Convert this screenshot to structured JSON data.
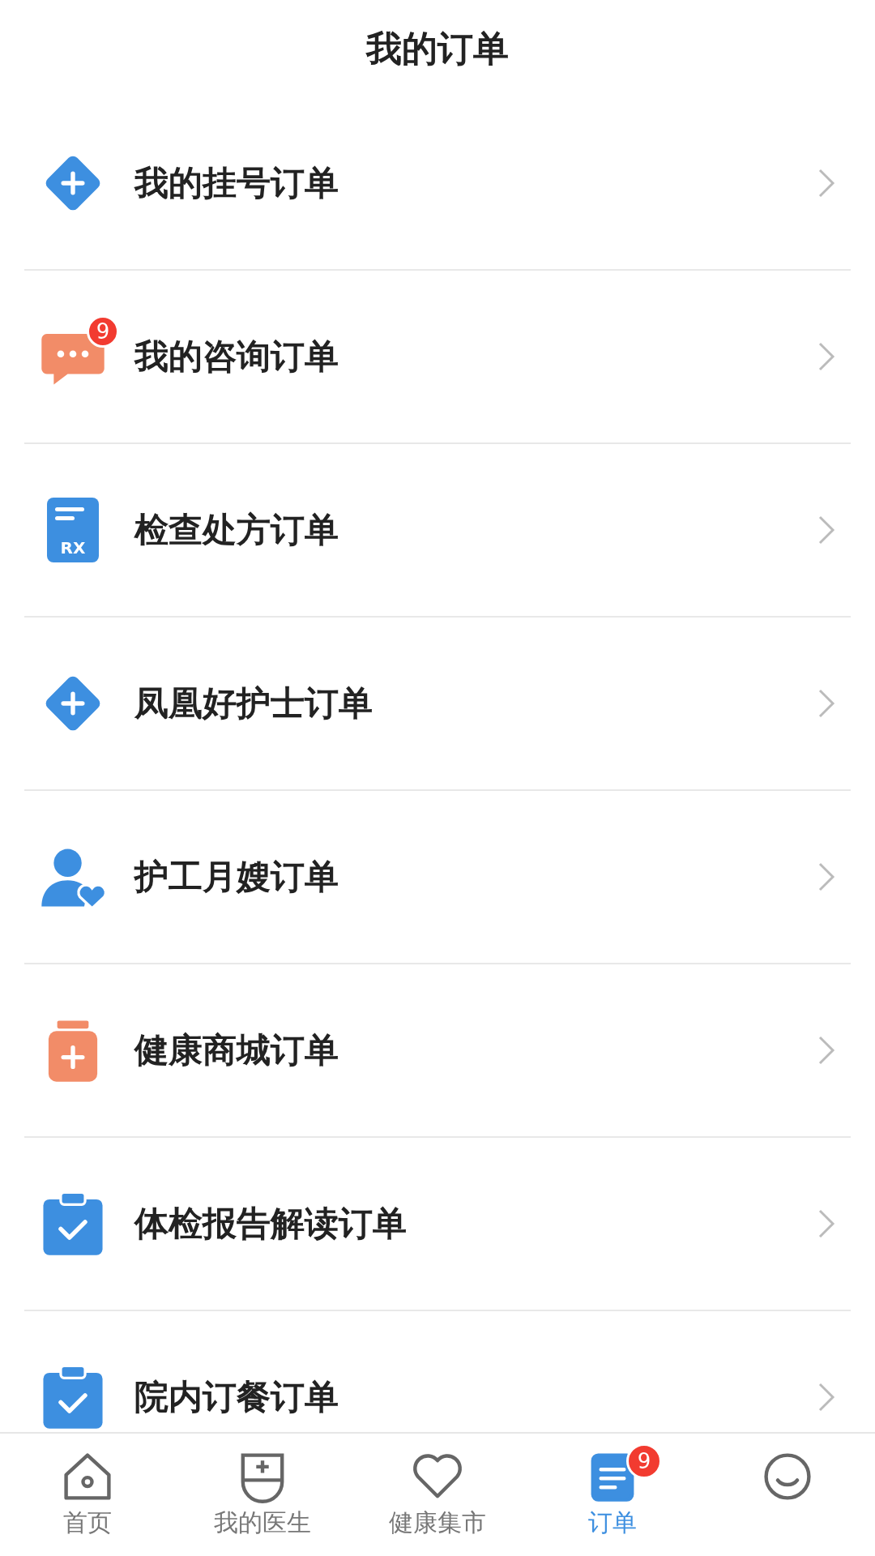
{
  "header": {
    "title": "我的订单"
  },
  "orders": [
    {
      "label": "我的挂号订单"
    },
    {
      "label": "我的咨询订单",
      "badge": "9"
    },
    {
      "label": "检查处方订单",
      "icon_text": "RX"
    },
    {
      "label": "凤凰好护士订单"
    },
    {
      "label": "护工月嫂订单"
    },
    {
      "label": "健康商城订单"
    },
    {
      "label": "体检报告解读订单"
    },
    {
      "label": "院内订餐订单"
    }
  ],
  "tab_bar": [
    {
      "label": "首页",
      "selected": false
    },
    {
      "label": "我的医生",
      "selected": false
    },
    {
      "label": "健康集市",
      "selected": false
    },
    {
      "label": "订单",
      "selected": true,
      "badge": "9"
    },
    {
      "selected": false
    }
  ]
}
